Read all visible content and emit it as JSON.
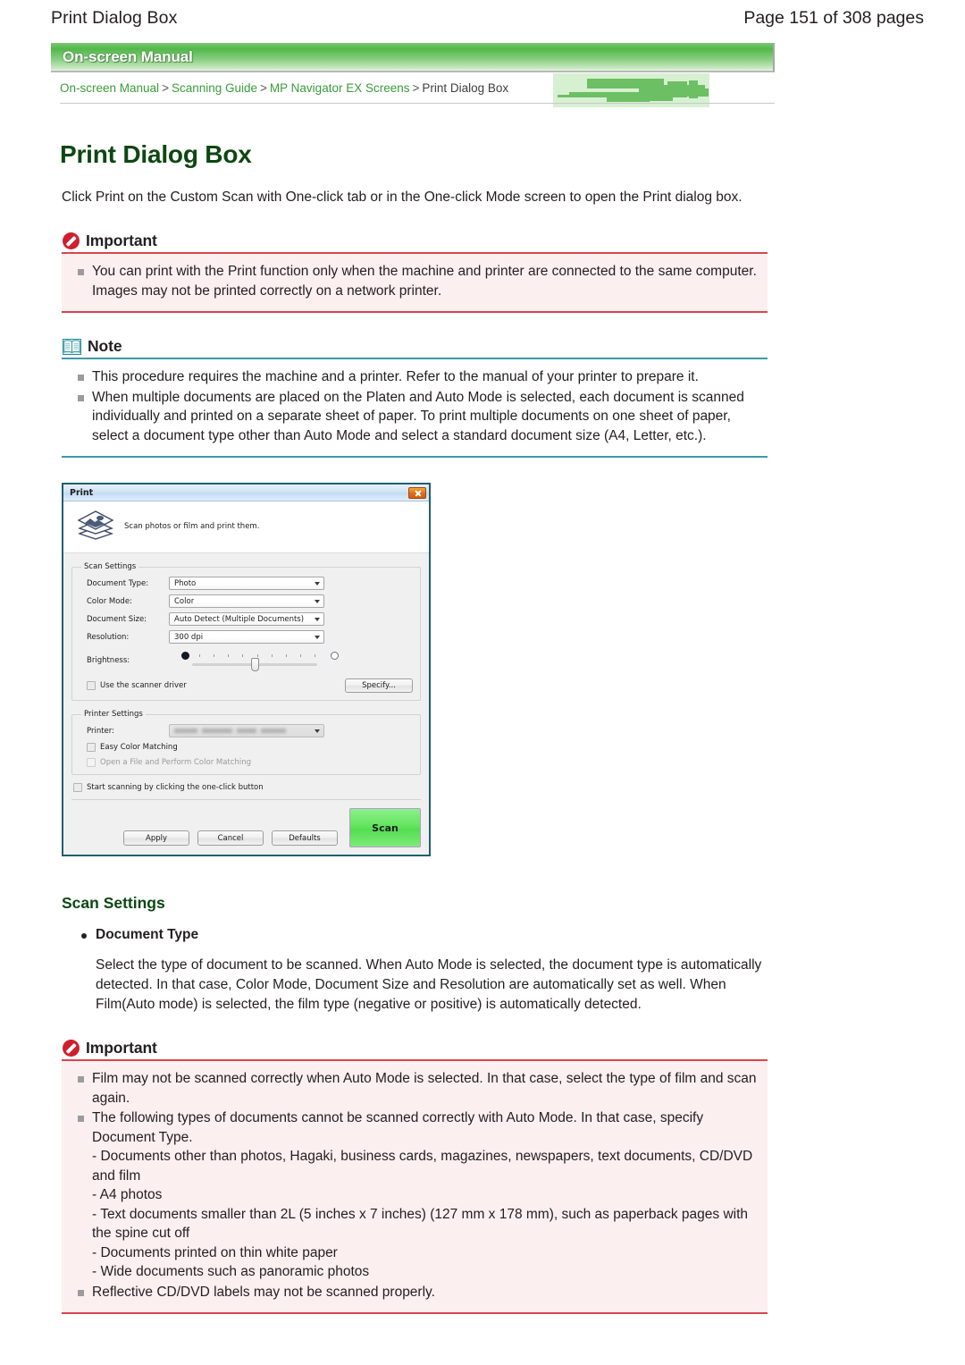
{
  "page_header": {
    "title": "Print Dialog Box",
    "pagination": "Page 151 of 308 pages"
  },
  "banner": {
    "label": "On-screen Manual"
  },
  "breadcrumb": {
    "items": [
      {
        "label": "On-screen Manual",
        "link": true
      },
      {
        "label": "Scanning Guide",
        "link": true
      },
      {
        "label": "MP Navigator EX Screens",
        "link": true
      },
      {
        "label": "Print Dialog Box",
        "link": false
      }
    ],
    "separator": ">"
  },
  "doc": {
    "title": "Print Dialog Box",
    "intro": "Click Print on the Custom Scan with One-click tab or in the One-click Mode screen to open the Print dialog box."
  },
  "important_1": {
    "heading": "Important",
    "icon": "prohibit-icon",
    "items": [
      "You can print with the Print function only when the machine and printer are connected to the same computer. Images may not be printed correctly on a network printer."
    ]
  },
  "note": {
    "heading": "Note",
    "icon": "open-book-icon",
    "items": [
      "This procedure requires the machine and a printer. Refer to the manual of your printer to prepare it.",
      "When multiple documents are placed on the Platen and Auto Mode is selected, each document is scanned individually and printed on a separate sheet of paper. To print multiple documents on one sheet of paper, select a document type other than Auto Mode and select a standard document size (A4, Letter, etc.)."
    ]
  },
  "dialog": {
    "title": "Print",
    "close_icon": "close-icon",
    "hero_icon": "photo-stack-icon",
    "hero_text": "Scan photos or film and print them.",
    "scan_settings": {
      "legend": "Scan Settings",
      "fields": [
        {
          "label": "Document Type:",
          "value": "Photo"
        },
        {
          "label": "Color Mode:",
          "value": "Color"
        },
        {
          "label": "Document Size:",
          "value": "Auto Detect (Multiple Documents)"
        },
        {
          "label": "Resolution:",
          "value": "300 dpi"
        }
      ],
      "brightness_label": "Brightness:",
      "scanner_driver_checkbox": "Use the scanner driver",
      "specify_button": "Specify..."
    },
    "printer_settings": {
      "legend": "Printer Settings",
      "printer_label": "Printer:",
      "printer_value": "",
      "easy_color_matching": "Easy Color Matching",
      "open_file_perform": "Open a File and Perform Color Matching"
    },
    "one_click_checkbox": "Start scanning by clicking the one-click button",
    "buttons": {
      "apply": "Apply",
      "cancel": "Cancel",
      "defaults": "Defaults",
      "scan": "Scan"
    }
  },
  "scan_settings_section": {
    "heading": "Scan Settings",
    "bullet": "Document Type",
    "body": "Select the type of document to be scanned. When Auto Mode is selected, the document type is automatically detected. In that case, Color Mode, Document Size and Resolution are automatically set as well. When Film(Auto mode) is selected, the film type (negative or positive) is automatically detected."
  },
  "important_2": {
    "heading": "Important",
    "icon": "prohibit-icon",
    "item1": "Film may not be scanned correctly when Auto Mode is selected. In that case, select the type of film and scan again.",
    "item2_lead": "The following types of documents cannot be scanned correctly with Auto Mode. In that case, specify Document Type.",
    "item2_subs": [
      "- Documents other than photos, Hagaki, business cards, magazines, newspapers, text documents, CD/DVD and film",
      "- A4 photos",
      "- Text documents smaller than 2L (5 inches x 7 inches) (127 mm x 178 mm), such as paperback pages with the spine cut off",
      "- Documents printed on thin white paper",
      "- Wide documents such as panoramic photos"
    ],
    "item3": "Reflective CD/DVD labels may not be scanned properly."
  },
  "colors": {
    "accent_green": "#3b9c3b",
    "title_green": "#0d4712",
    "important_red": "#d8464f",
    "important_bg": "#fceff0",
    "note_teal": "#3b9aa8",
    "scan_button_green": "#63e55f"
  }
}
